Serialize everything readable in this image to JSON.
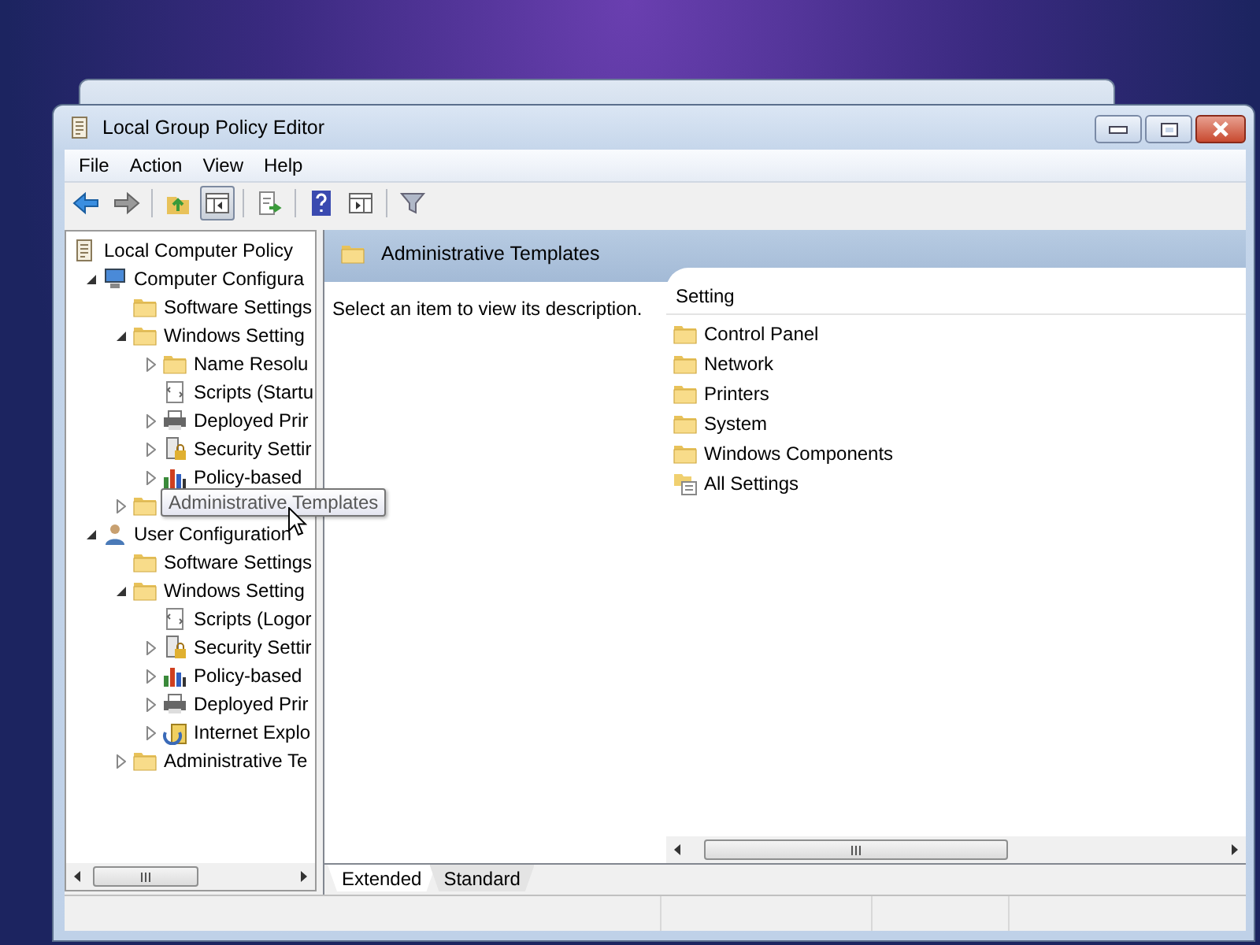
{
  "window": {
    "title": "Local Group Policy Editor"
  },
  "menu": [
    "File",
    "Action",
    "View",
    "Help"
  ],
  "toolbar": [
    [
      {
        "kind": "back",
        "pressed": false
      },
      {
        "kind": "forward",
        "pressed": false
      }
    ],
    [
      {
        "kind": "up",
        "pressed": false
      },
      {
        "kind": "tree",
        "pressed": true
      }
    ],
    [
      {
        "kind": "export",
        "pressed": false
      }
    ],
    [
      {
        "kind": "help",
        "pressed": false
      },
      {
        "kind": "pane",
        "pressed": false
      }
    ],
    [
      {
        "kind": "filter",
        "pressed": false
      }
    ]
  ],
  "tree": {
    "items": [
      {
        "label": "Local Computer Policy",
        "kind": "policy",
        "children": [
          {
            "label": "Computer Configura",
            "kind": "computer",
            "expanded": true,
            "children": [
              {
                "label": "Software Settings",
                "kind": "folder"
              },
              {
                "label": "Windows Setting",
                "kind": "folder",
                "expanded": true,
                "children": [
                  {
                    "label": "Name Resolu",
                    "kind": "folder",
                    "expanded": false
                  },
                  {
                    "label": "Scripts (Startu",
                    "kind": "script"
                  },
                  {
                    "label": "Deployed Prir",
                    "kind": "printer",
                    "expanded": false
                  },
                  {
                    "label": "Security Settir",
                    "kind": "security",
                    "expanded": false
                  },
                  {
                    "label": "Policy-based",
                    "kind": "chart",
                    "expanded": false
                  }
                ]
              },
              {
                "kind": "folder",
                "expanded": false
              }
            ]
          },
          {
            "label": "User Configuration",
            "kind": "user",
            "expanded": true,
            "children": [
              {
                "label": "Software Settings",
                "kind": "folder"
              },
              {
                "label": "Windows Setting",
                "kind": "folder",
                "expanded": true,
                "children": [
                  {
                    "label": "Scripts (Logor",
                    "kind": "script"
                  },
                  {
                    "label": "Security Settir",
                    "kind": "security",
                    "expanded": false
                  },
                  {
                    "label": "Policy-based",
                    "kind": "chart",
                    "expanded": false
                  },
                  {
                    "label": "Deployed Prir",
                    "kind": "printer",
                    "expanded": false
                  },
                  {
                    "label": "Internet Explo",
                    "kind": "ie",
                    "expanded": false
                  }
                ]
              },
              {
                "label": "Administrative Te",
                "kind": "folder",
                "expanded": false
              }
            ]
          }
        ]
      }
    ]
  },
  "tooltip": {
    "text": "Administrative Templates"
  },
  "details": {
    "header": "Administrative Templates",
    "description": "Select an item to view its description.",
    "column": "Setting",
    "items": [
      {
        "label": "Control Panel",
        "kind": "folder"
      },
      {
        "label": "Network",
        "kind": "folder"
      },
      {
        "label": "Printers",
        "kind": "folder"
      },
      {
        "label": "System",
        "kind": "folder"
      },
      {
        "label": "Windows Components",
        "kind": "folder"
      },
      {
        "label": "All Settings",
        "kind": "all-settings"
      }
    ]
  },
  "tabs": [
    {
      "label": "Extended",
      "selected": true
    },
    {
      "label": "Standard",
      "selected": false
    }
  ]
}
